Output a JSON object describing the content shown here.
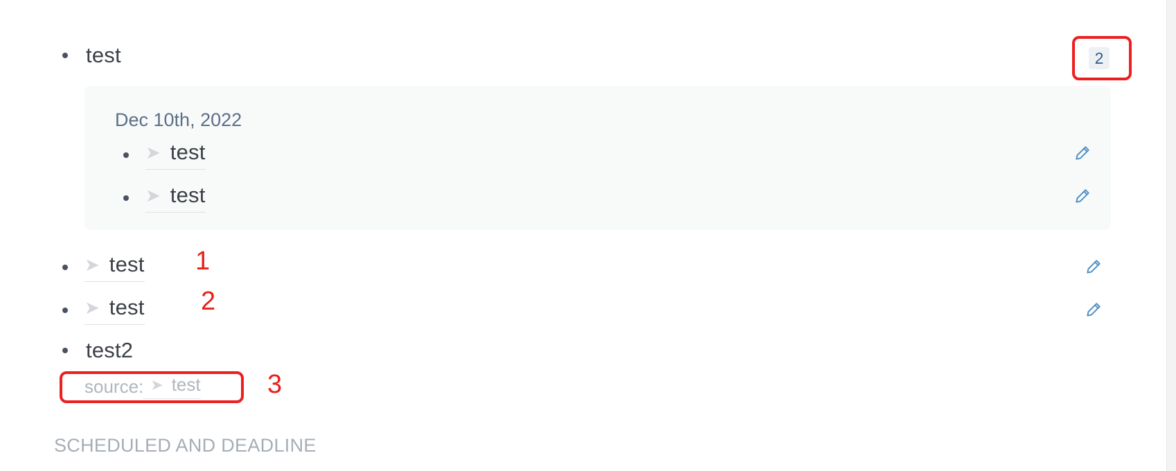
{
  "top_block": {
    "text": "test",
    "ref_count": "2"
  },
  "reference_group": {
    "date": "Dec 10th, 2022",
    "items": [
      {
        "arrow": "➤",
        "text": "test"
      },
      {
        "arrow": "➤",
        "text": "test"
      }
    ]
  },
  "outline_items": [
    {
      "arrow": "➤",
      "text": "test",
      "annotation": "1"
    },
    {
      "arrow": "➤",
      "text": "test",
      "annotation": "2"
    }
  ],
  "test2_block": {
    "text": "test2",
    "source_label": "source:",
    "source_arrow": "➤",
    "source_text": "test",
    "annotation": "3"
  },
  "section": {
    "title": "SCHEDULED AND DEADLINE"
  },
  "colors": {
    "annotation_red": "#ee1e1e",
    "pencil_blue": "#4f8fc4",
    "badge_text": "#2c5e8c"
  },
  "icons": {
    "edit": "pencil-icon",
    "bullet": "bullet-dot",
    "arrow": "arrow-right"
  }
}
